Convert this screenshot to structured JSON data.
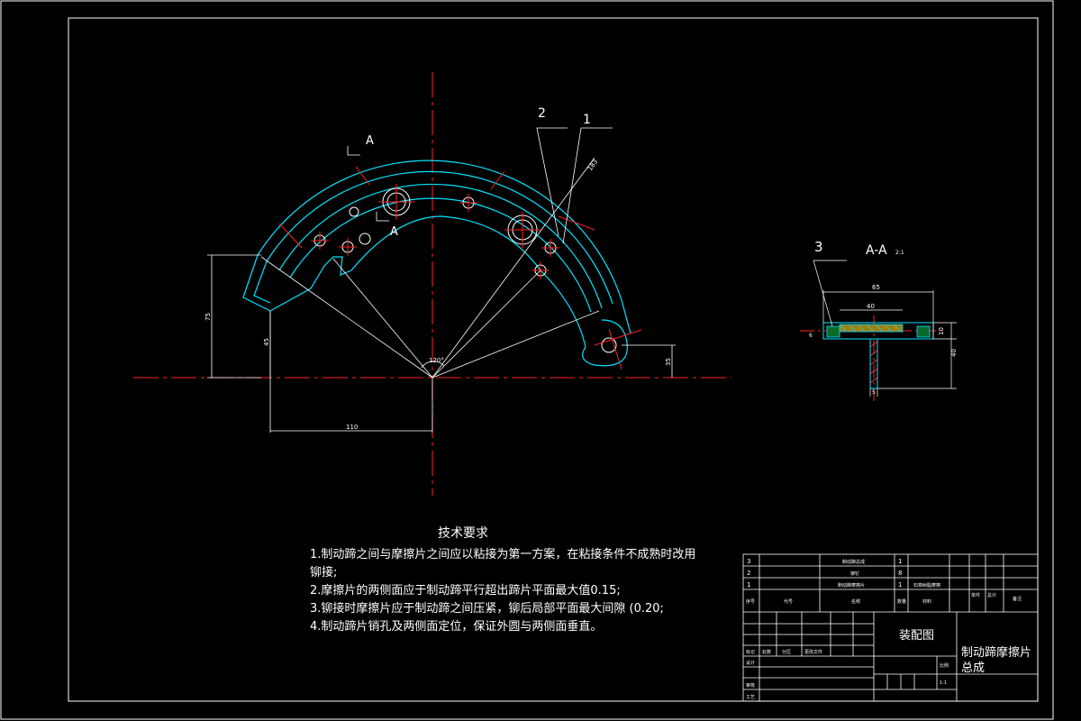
{
  "drawing": {
    "section_label": "A-A",
    "section_scale": "2:1",
    "cut_marker_top": "A",
    "cut_marker_bottom": "A",
    "callouts": [
      "1",
      "2",
      "3"
    ],
    "dimensions": {
      "height_75": "75",
      "height_45": "45",
      "width_110": "110",
      "angle_120": "120°",
      "radius_183": "183",
      "height_35": "35",
      "sec_65": "65",
      "sec_40": "40",
      "sec_10": "10",
      "sec_40v": "40",
      "sec_6": "6",
      "sec_5": "5"
    }
  },
  "requirements": {
    "title": "技术要求",
    "items": [
      "1.制动蹄之间与摩擦片之间应以粘接为第一方案，在粘接条件不成熟时改用",
      "铆接;",
      "2.摩擦片的两侧面应于制动蹄平行超出蹄片平面最大值0.15;",
      "3.铆接时摩擦片应于制动蹄之间压紧，铆后局部平面最大间隙 (0.20;",
      "4.制动蹄片销孔及两侧面定位，保证外圆与两侧面垂直。"
    ]
  },
  "title_block": {
    "parts": [
      {
        "no": "3",
        "name": "制动蹄总成",
        "qty": "1"
      },
      {
        "no": "2",
        "name": "铆钉",
        "qty": "8"
      },
      {
        "no": "1",
        "name": "制动蹄摩擦片",
        "qty": "1",
        "material": "石棉树脂摩擦"
      }
    ],
    "header": {
      "no": "序号",
      "code": "代号",
      "name": "名称",
      "qty": "数量",
      "material": "材料",
      "unit_w": "单件",
      "total_w": "总计",
      "remark": "备注"
    },
    "rev_labels": [
      "标记",
      "处数",
      "分区",
      "更改文件"
    ],
    "role_labels": [
      "设计",
      "审核",
      "工艺"
    ],
    "drawing_type": "装配图",
    "drawing_title": [
      "制动蹄摩擦片",
      "总成"
    ],
    "scale_label": "比例",
    "scale_value": "1:1"
  }
}
